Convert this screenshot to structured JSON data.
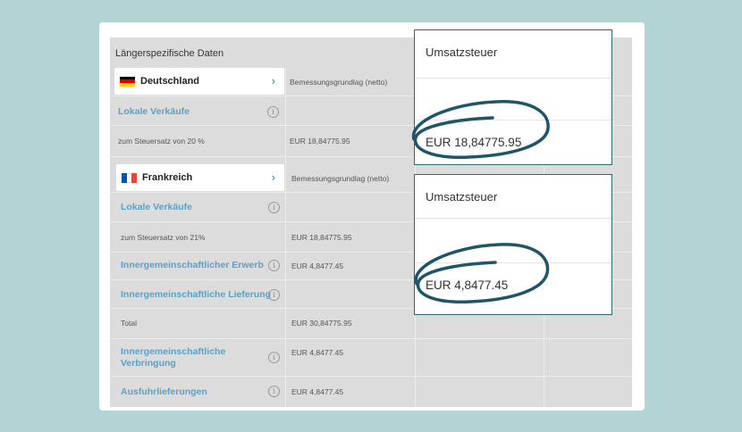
{
  "panel": {
    "title": "Längerspezifische Daten"
  },
  "germany": {
    "name": "Deutschland",
    "flag_colors": [
      "#000000",
      "#dd0000",
      "#ffce00"
    ],
    "column_header": "Bemessungsgrundlag (netto)",
    "local_sales_label": "Lokale Verkäufe",
    "tax_rate_label": "zum Steuersatz von 20 %",
    "tax_rate_amount": "EUR 18,84775.95"
  },
  "france": {
    "name": "Frankreich",
    "flag_colors": [
      "#0055a4",
      "#ffffff",
      "#ef4135"
    ],
    "column_header": "Bemessungsgrundlag (netto)",
    "local_sales_label": "Lokale Verkäufe",
    "tax_rate_label": "zum Steuersatz von 21%",
    "tax_rate_amount": "EUR 18,84775.95",
    "acquisition_label": "Innergemeinschaftlicher Erwerb",
    "acquisition_amount": "EUR 4,8477.45",
    "delivery_label": "Innergemeinschaftliche Lieferung",
    "total_label": "Total",
    "total_amount": "EUR 30,84775.95",
    "transfer_label_line1": "Innergemeinschaftliche",
    "transfer_label_line2": "Verbringung",
    "transfer_amount": "EUR 4,8477.45",
    "export_label": "Ausfuhrlieferungen",
    "export_amount": "EUR 4,8477.45"
  },
  "callouts": [
    {
      "header": "Umsatzsteuer",
      "value": "EUR 18,84775.95"
    },
    {
      "header": "Umsatzsteuer",
      "value": "EUR 4,8477.45"
    }
  ],
  "icons": {
    "info": "info-icon",
    "chevron": "chevron-right-icon"
  },
  "colors": {
    "accent": "#2d6b6f",
    "link": "#5aa1c5",
    "chevron": "#2f86b5"
  }
}
